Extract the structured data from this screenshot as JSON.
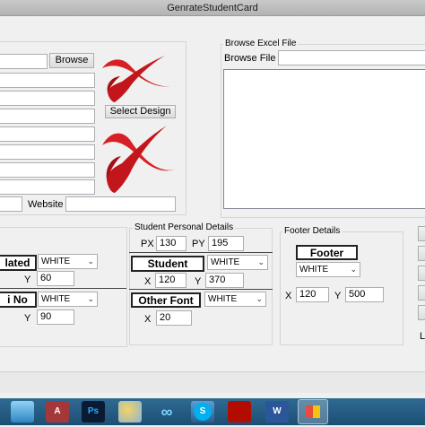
{
  "window": {
    "title": "GenrateStudentCard"
  },
  "left_panel": {
    "browse_label": "Browse",
    "select_design_label": "Select Design",
    "website_label": "Website",
    "field_values": [
      "",
      "",
      "",
      "",
      "",
      "",
      "",
      "",
      "",
      ""
    ]
  },
  "excel": {
    "group_title": "Browse Excel File",
    "browse_file_label": "Browse File :",
    "path_value": ""
  },
  "institute": {
    "related_label": "lated",
    "related_color": "WHITE",
    "related_y_label": "Y",
    "related_y_value": "60",
    "no_label": "i No",
    "no_color": "WHITE",
    "no_y_label": "Y",
    "no_y_value": "90"
  },
  "student": {
    "group_title": "Student Personal Details",
    "px_label": "PX",
    "px_value": "130",
    "py_label": "PY",
    "py_value": "195",
    "student_label": "Student",
    "student_color": "WHITE",
    "x_label": "X",
    "x_value": "120",
    "y_label": "Y",
    "y_value": "370",
    "other_font_label": "Other Font",
    "other_font_color": "WHITE",
    "other_x_label": "X",
    "other_x_value": "20"
  },
  "footer": {
    "group_title": "Footer Details",
    "footer_label": "Footer",
    "footer_color": "WHITE",
    "x_label": "X",
    "x_value": "120",
    "y_label": "Y",
    "y_value": "500"
  },
  "right_edge": {
    "partial_label": "L"
  },
  "taskbar": {
    "apps": [
      {
        "name": "explorer",
        "glyph": ""
      },
      {
        "name": "access",
        "glyph": "A"
      },
      {
        "name": "photoshop",
        "glyph": "Ps"
      },
      {
        "name": "paint",
        "glyph": ""
      },
      {
        "name": "network",
        "glyph": "∞"
      },
      {
        "name": "visual-studio",
        "glyph": ""
      },
      {
        "name": "skype",
        "glyph": "S"
      },
      {
        "name": "acrobat",
        "glyph": ""
      },
      {
        "name": "word",
        "glyph": "W"
      },
      {
        "name": "active-window",
        "glyph": ""
      }
    ]
  }
}
